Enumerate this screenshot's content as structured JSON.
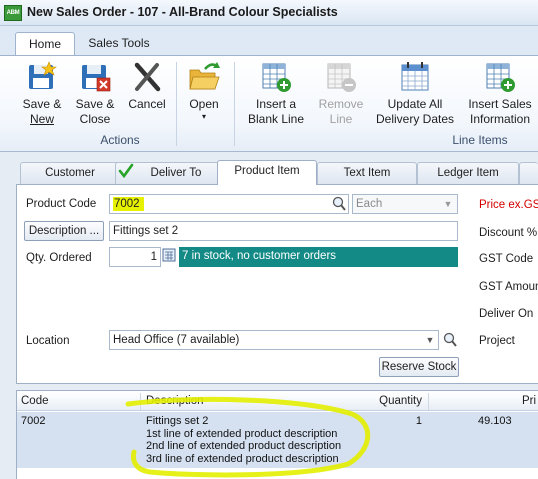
{
  "window": {
    "app_icon_text": "ABM",
    "title": "New Sales Order - 107 - All-Brand Colour Specialists"
  },
  "ribbon": {
    "tabs": [
      "Home",
      "Sales Tools"
    ],
    "buttons": {
      "save_new": [
        "Save &",
        "New"
      ],
      "save_close": [
        "Save &",
        "Close"
      ],
      "cancel": "Cancel",
      "open": "Open",
      "insert_blank_line": [
        "Insert a",
        "Blank Line"
      ],
      "remove_line": [
        "Remove",
        "Line"
      ],
      "update_delivery_dates": [
        "Update All",
        "Delivery Dates"
      ],
      "insert_sales_info": [
        "Insert Sales",
        "Information"
      ]
    },
    "groups": {
      "actions": "Actions",
      "line_items": "Line Items"
    }
  },
  "form_tabs": [
    "Customer",
    "Deliver To",
    "Product Item",
    "Text Item",
    "Ledger Item"
  ],
  "product": {
    "product_code_label": "Product Code",
    "product_code_value": "7002",
    "unit_value": "Each",
    "description_button": "Description ...",
    "description_value": "Fittings set 2",
    "qty_label": "Qty. Ordered",
    "qty_value": "1",
    "stock_status": "7 in stock, no customer orders",
    "location_label": "Location",
    "location_value": "Head Office (7 available)",
    "reserve_stock_button": "Reserve Stock"
  },
  "right_labels": {
    "price": "Price ex.GST",
    "discount": "Discount %",
    "gst_code": "GST Code",
    "gst_amount": "GST Amount",
    "deliver_on": "Deliver On",
    "project": "Project"
  },
  "grid": {
    "headers": {
      "code": "Code",
      "description": "Description",
      "quantity": "Quantity",
      "price": "Pri"
    },
    "rows": [
      {
        "code": "7002",
        "description_lines": [
          "Fittings set 2",
          "1st line of extended product description",
          "2nd line of extended product description",
          "3rd line of extended product description"
        ],
        "quantity": "1",
        "price": "49.103"
      }
    ]
  },
  "colors": {
    "stock_status_bg": "#138a86",
    "highlight": "#e6f100",
    "price_label": "#d40000"
  }
}
